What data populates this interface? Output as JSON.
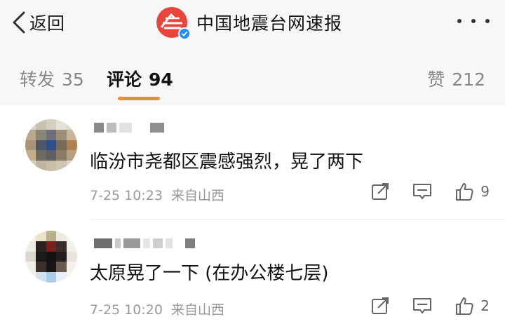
{
  "header": {
    "back_label": "返回",
    "title": "中国地震台网速报",
    "brand_color": "#e8453c"
  },
  "tabs": {
    "repost": {
      "label": "转发",
      "count": "35"
    },
    "comments": {
      "label": "评论",
      "count": "94"
    },
    "likes": {
      "label": "赞",
      "count": "212"
    },
    "active": "comments",
    "active_color": "#f28a32"
  },
  "comments": [
    {
      "text": "临汾市尧都区震感强烈，晃了两下",
      "time": "7-25 10:23",
      "location": "来自山西",
      "likes": "9"
    },
    {
      "text": "太原晃了一下 (在办公楼七层)",
      "time": "7-25 10:20",
      "location": "来自山西",
      "likes": "2"
    }
  ],
  "icons": [
    "back-chevron-icon",
    "brand-logo-icon",
    "verified-icon",
    "more-icon",
    "share-icon",
    "reply-icon",
    "thumbs-up-icon"
  ]
}
